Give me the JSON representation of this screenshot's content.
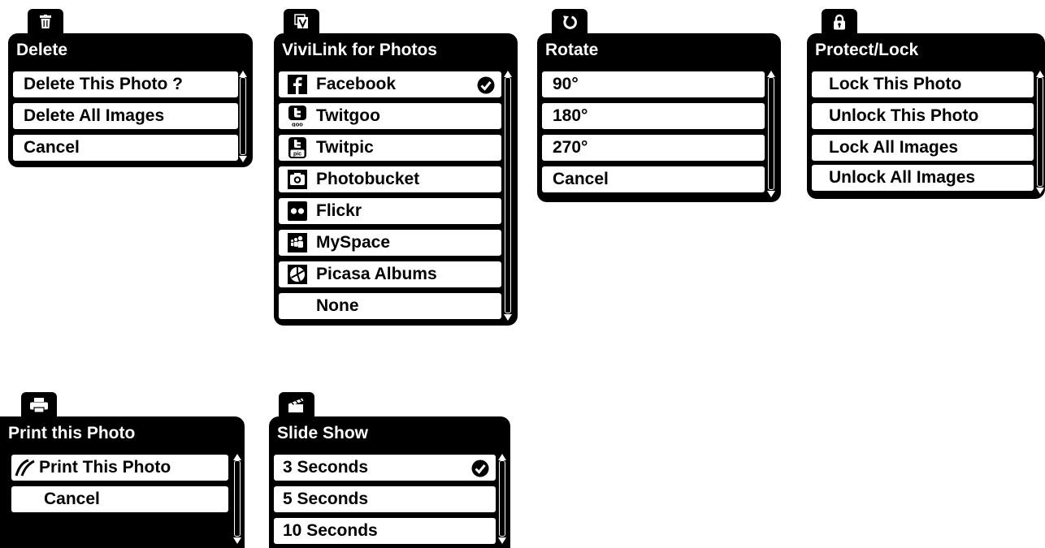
{
  "delete": {
    "title": "Delete",
    "tab_icon": "trash-icon",
    "items": [
      "Delete This Photo ?",
      "Delete All Images",
      "Cancel"
    ]
  },
  "vivilink": {
    "title": "ViviLink for Photos",
    "tab_icon": "vivilink-icon",
    "items": [
      {
        "label": "Facebook",
        "icon": "facebook-icon",
        "checked": true
      },
      {
        "label": "Twitgoo",
        "icon": "twitgoo-icon"
      },
      {
        "label": "Twitpic",
        "icon": "twitpic-icon"
      },
      {
        "label": "Photobucket",
        "icon": "photobucket-icon"
      },
      {
        "label": "Flickr",
        "icon": "flickr-icon"
      },
      {
        "label": "MySpace",
        "icon": "myspace-icon"
      },
      {
        "label": "Picasa Albums",
        "icon": "picasa-icon"
      },
      {
        "label": "None"
      }
    ]
  },
  "rotate": {
    "title": "Rotate",
    "tab_icon": "rotate-icon",
    "items": [
      "90°",
      "180°",
      "270°",
      "Cancel"
    ]
  },
  "protect": {
    "title": "Protect/Lock",
    "tab_icon": "lock-icon",
    "items": [
      "Lock This Photo",
      "Unlock This Photo",
      "Lock All Images",
      "Unlock All Images"
    ]
  },
  "print": {
    "title": "Print this Photo",
    "tab_icon": "printer-icon",
    "items": [
      {
        "label": "Print This Photo",
        "icon": "pictbridge-icon"
      },
      {
        "label": "Cancel"
      }
    ]
  },
  "slideshow": {
    "title": "Slide Show",
    "tab_icon": "clapperboard-icon",
    "items": [
      {
        "label": "3 Seconds",
        "checked": true
      },
      {
        "label": "5 Seconds"
      },
      {
        "label": "10 Seconds"
      }
    ]
  }
}
